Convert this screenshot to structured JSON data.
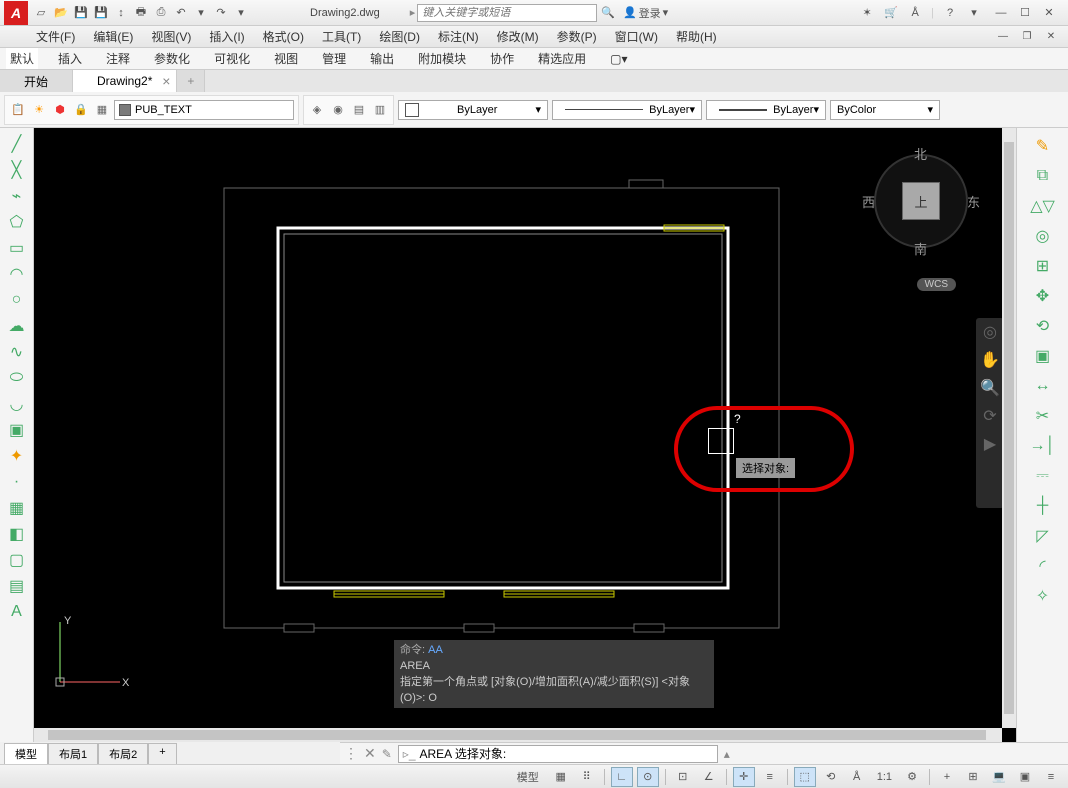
{
  "title": "Drawing2.dwg",
  "search_placeholder": "键入关键字或短语",
  "login": "登录",
  "menus": [
    "文件(F)",
    "编辑(E)",
    "视图(V)",
    "插入(I)",
    "格式(O)",
    "工具(T)",
    "绘图(D)",
    "标注(N)",
    "修改(M)",
    "参数(P)",
    "窗口(W)",
    "帮助(H)"
  ],
  "ribbon_tabs": [
    "默认",
    "插入",
    "注释",
    "参数化",
    "可视化",
    "视图",
    "管理",
    "输出",
    "附加模块",
    "协作",
    "精选应用"
  ],
  "doc_tabs": [
    {
      "label": "开始"
    },
    {
      "label": "Drawing2*",
      "active": true
    }
  ],
  "layer_name": "PUB_TEXT",
  "prop_layer_color": "ByLayer",
  "prop_layer_ltype": "ByLayer",
  "prop_layer_lweight": "ByLayer",
  "prop_bycolor": "ByColor",
  "viewcube": {
    "top": "上",
    "n": "北",
    "s": "南",
    "e": "东",
    "w": "西"
  },
  "wcs": "WCS",
  "tooltip": "选择对象:",
  "cursor_hint": "?",
  "cmd_history": {
    "l1": "命令: AA",
    "l2": "AREA",
    "l3": "指定第一个角点或 [对象(O)/增加面积(A)/减少面积(S)] <对象(O)>: O"
  },
  "cmdline_label": "AREA 选择对象:",
  "model_tabs": [
    "模型",
    "布局1",
    "布局2"
  ],
  "ucs": {
    "x": "X",
    "y": "Y"
  },
  "status_scale": "1:1",
  "status_model": "模型"
}
